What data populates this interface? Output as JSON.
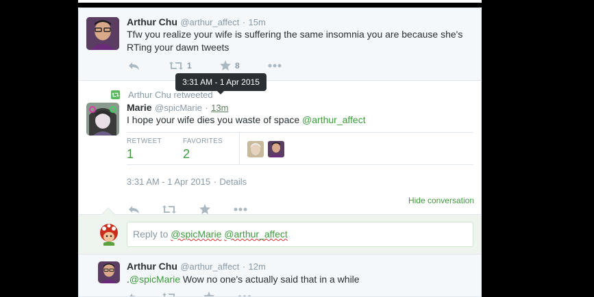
{
  "tweet1": {
    "name": "Arthur Chu",
    "handle": "@arthur_affect",
    "sep": "·",
    "time": "15m",
    "text": "Tfw you realize your wife is suffering the same insomnia you are because she's RTing your dawn tweets",
    "retweet_count": "1",
    "favorite_count": "8"
  },
  "tooltip": "3:31 AM - 1 Apr 2015",
  "tweet2": {
    "retweeted_by": "Arthur Chu retweeted",
    "name": "Marie",
    "handle": "@spicMarie",
    "sep": "·",
    "time": "13m",
    "text_prefix": "I hope your wife dies you waste of space ",
    "mention": "@arthur_affect",
    "retweet_label": "RETWEET",
    "retweet_value": "1",
    "favorites_label": "FAVORITES",
    "favorites_value": "2",
    "timestamp": "3:31 AM - 1 Apr 2015",
    "details_sep": "·",
    "details": "Details",
    "hide_conversation": "Hide conversation"
  },
  "reply": {
    "prefix": "Reply to ",
    "mention1": "@spicMarie",
    "mention2": "@arthur_affect"
  },
  "tweet3": {
    "name": "Arthur Chu",
    "handle": "@arthur_affect",
    "sep": "·",
    "time": "12m",
    "text_prefix": ".",
    "mention": "@spicMarie",
    "text_suffix": " Wow no one's actually said that in a while"
  },
  "colors": {
    "accent_green": "#3b9b3b",
    "link_blue": "#2b7bb9",
    "muted": "#8899a6"
  },
  "icons": [
    "reply-icon",
    "retweet-icon",
    "star-icon",
    "more-icon",
    "retweeted-icon"
  ]
}
